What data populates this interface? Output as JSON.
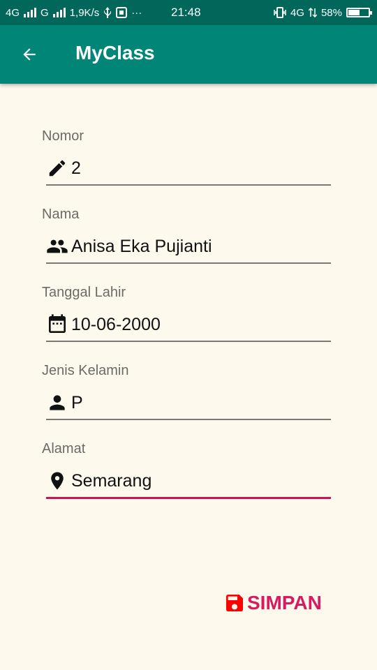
{
  "status_bar": {
    "network_left": "4G",
    "signal_label": "G",
    "speed": "1,9K/s",
    "more": "···",
    "time": "21:48",
    "network_right": "4G",
    "battery": "58%"
  },
  "app_bar": {
    "title": "MyClass",
    "back_icon": "arrow-left-icon"
  },
  "form": {
    "fields": [
      {
        "label": "Nomor",
        "value": "2",
        "icon": "pencil-icon"
      },
      {
        "label": "Nama",
        "value": "Anisa Eka Pujianti",
        "icon": "people-icon"
      },
      {
        "label": "Tanggal Lahir",
        "value": "10-06-2000",
        "icon": "calendar-icon"
      },
      {
        "label": "Jenis Kelamin",
        "value": "P",
        "icon": "person-icon"
      },
      {
        "label": "Alamat",
        "value": "Semarang",
        "icon": "location-pin-icon"
      }
    ]
  },
  "actions": {
    "save_label": "SIMPAN",
    "save_icon": "floppy-disk-icon"
  },
  "colors": {
    "status_bar": "#00675a",
    "app_bar": "#008577",
    "background": "#fdf9ed",
    "accent": "#d81b60",
    "save_icon": "#ff0000"
  }
}
